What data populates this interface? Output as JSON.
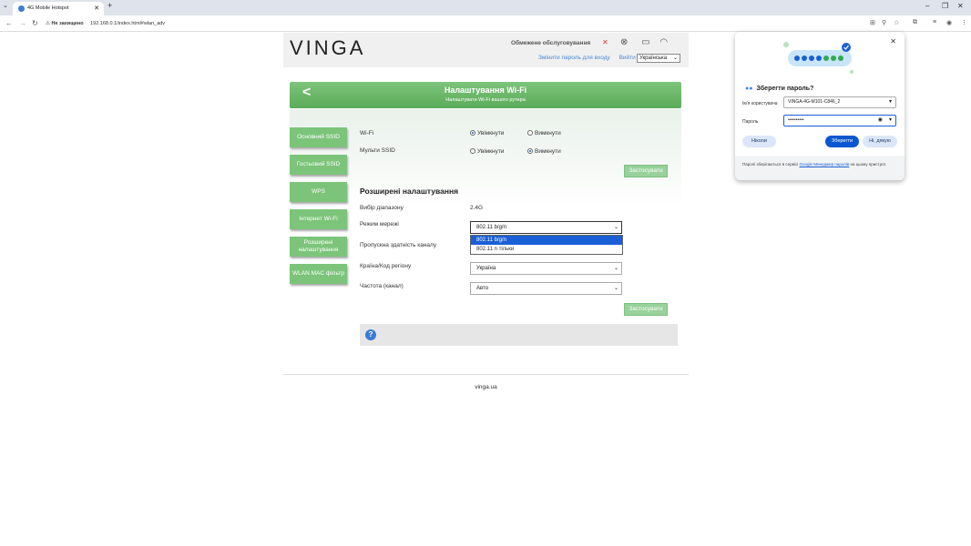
{
  "browser": {
    "tab_title": "4G Mobile Hotspot",
    "security": "Не захищено",
    "url": "192.168.0.1/index.html#wlan_adv"
  },
  "header": {
    "logo": "VINGA",
    "service": "Обмежене обслуговування",
    "change_password": "Змінити пароль для входу",
    "logout": "Вийти",
    "language": "Українська"
  },
  "title": {
    "main": "Налаштування Wi-Fi",
    "sub": "Налаштувати Wi-Fi вашого рутера"
  },
  "sidebar": {
    "items": [
      {
        "label": "Основний SSID"
      },
      {
        "label": "Гостьовий SSID"
      },
      {
        "label": "WPS"
      },
      {
        "label": "Інтернет Wi-Fi"
      },
      {
        "label": "Розширені налаштування"
      },
      {
        "label": "WLAN MAC фільтр"
      }
    ]
  },
  "basic": {
    "wifi_label": "Wi-Fi",
    "multi_ssid_label": "Мульти SSID",
    "on": "Увімкнути",
    "off": "Вимкнути",
    "wifi_state": "on",
    "multi_ssid_state": "off",
    "apply": "Застосувати"
  },
  "advanced": {
    "heading": "Розширені налаштування",
    "band_label": "Вибір діапазону",
    "band_value": "2.4G",
    "mode_label": "Режим мережі",
    "mode_value": "802.11 b/g/n",
    "mode_options": [
      "802.11 b/g/n",
      "802.11 n тільки"
    ],
    "bandwidth_label": "Пропускна здатність каналу",
    "country_label": "Країна/Код регіону",
    "country_value": "Україна",
    "channel_label": "Частота (канал)",
    "channel_value": "Авто",
    "apply": "Застосувати"
  },
  "footer": {
    "text": "vinga.ua"
  },
  "password_popup": {
    "title": "Зберегти пароль?",
    "username_label": "Ім'я користувача",
    "username_value": "VINGA-4G-M101-C846_2",
    "password_label": "Пароль",
    "password_value": "••••••••••",
    "never": "Ніколи",
    "save": "Зберегти",
    "no_thanks": "Ні, дякую",
    "note_start": "Паролі зберігаються в сервісі",
    "note_link": "Google Менеджер паролів",
    "note_end": "на цьому пристрої."
  },
  "colors": {
    "accent_green": "#5bab59",
    "blue": "#1a5fd6"
  }
}
